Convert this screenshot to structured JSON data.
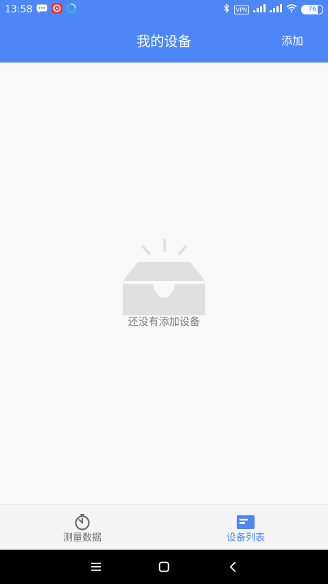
{
  "status_bar": {
    "time": "13:58",
    "vpn": "VPN",
    "battery": "76",
    "battery_level": 0.76
  },
  "header": {
    "title": "我的设备",
    "add_label": "添加"
  },
  "content": {
    "empty_text": "还没有添加设备"
  },
  "tabbar": {
    "tabs": [
      {
        "label": "测量数据",
        "icon": "timer-icon",
        "active": false
      },
      {
        "label": "设备列表",
        "icon": "list-card-icon",
        "active": true
      }
    ]
  },
  "nav_bar": {
    "icons": [
      "menu-icon",
      "home-icon",
      "back-icon"
    ]
  },
  "colors": {
    "primary": "#4d87f7",
    "background": "#f8f8f8",
    "tab_inactive": "#6b6b6b",
    "empty_graphic": "#e0e0e0"
  }
}
